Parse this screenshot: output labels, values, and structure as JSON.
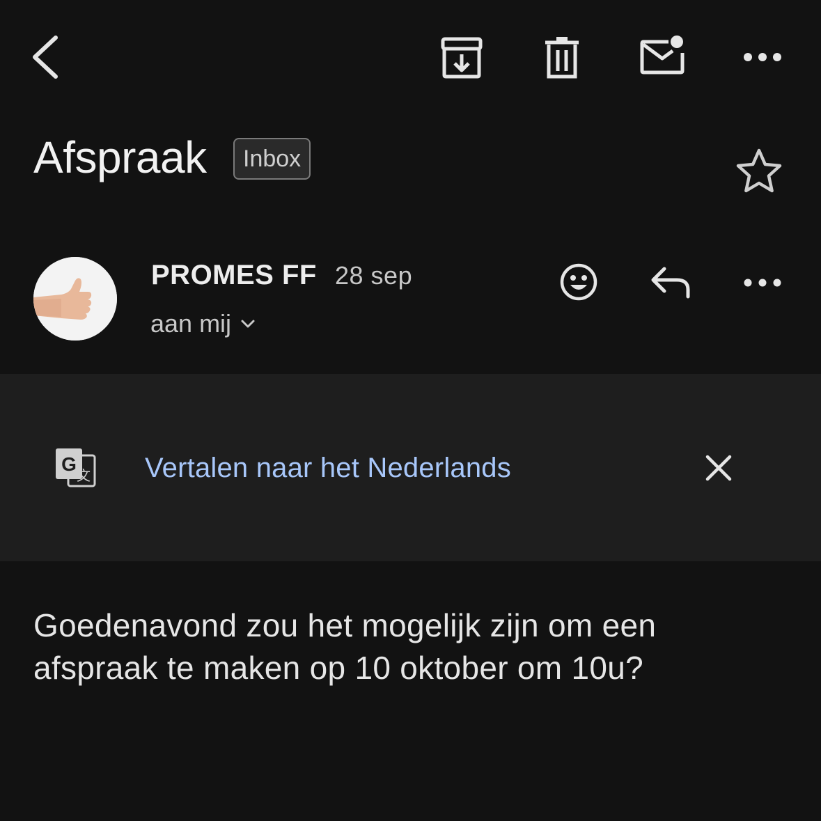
{
  "toolbar": {
    "back_icon": "chevron-left-icon",
    "archive_icon": "archive-icon",
    "delete_icon": "trash-icon",
    "mark_unread_icon": "mail-unread-icon",
    "more_icon": "more-horizontal-icon"
  },
  "email": {
    "subject": "Afspraak",
    "label": "Inbox",
    "star_icon": "star-outline-icon"
  },
  "sender": {
    "name": "PROMES FF",
    "date": "28 sep",
    "recipient": "aan mij",
    "avatar": "thumbs-up-avatar",
    "actions": {
      "emoji_icon": "emoji-reaction-icon",
      "reply_icon": "reply-icon",
      "more_icon": "more-horizontal-icon"
    }
  },
  "translate": {
    "icon": "google-translate-icon",
    "link_text": "Vertalen naar het Nederlands",
    "close_icon": "close-icon"
  },
  "body": {
    "text": "Goedenavond zou het mogelijk zijn om een afspraak te maken op 10 oktober om 10u?"
  },
  "colors": {
    "background": "#121212",
    "translate_bar": "#1e1e1e",
    "link": "#a8c7fa"
  }
}
